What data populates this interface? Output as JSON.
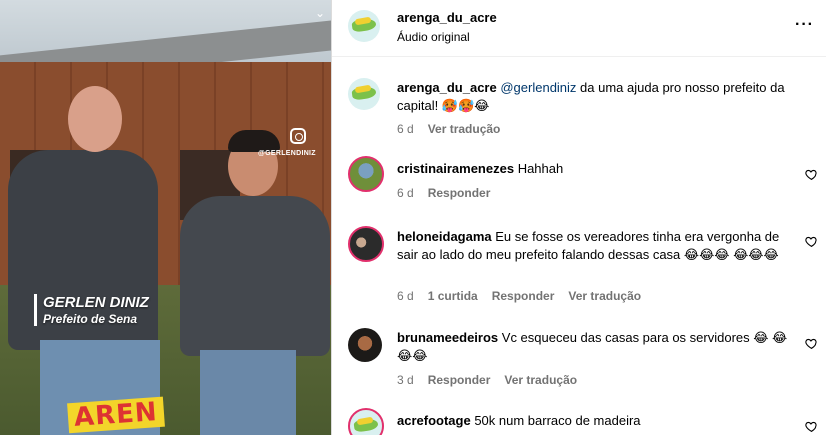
{
  "media": {
    "overlay_name": "GERLEN DINIZ",
    "overlay_role": "Prefeito de Sena",
    "watermark_handle": "@GERLENDINIZ",
    "logo_text": "AREN"
  },
  "header": {
    "username": "arenga_du_acre",
    "audio": "Áudio original",
    "more_icon": "more-icon"
  },
  "caption": {
    "username": "arenga_du_acre",
    "mention": "@gerlendiniz",
    "text": " da uma ajuda pro nosso prefeito da capital! 🥵🥵😂",
    "time": "6 d",
    "translate": "Ver tradução"
  },
  "comments": [
    {
      "username": "cristinairamenezes",
      "text": " Hahhah",
      "time": "6 d",
      "reply": "Responder"
    },
    {
      "username": "heloneidagama",
      "text": " Eu se fosse os vereadores tinha era vergonha de sair ao lado do meu prefeito falando dessas casa 😂😂😂 😂😂😂",
      "time": "6 d",
      "likes": "1 curtida",
      "reply": "Responder",
      "translate": "Ver tradução"
    },
    {
      "username": "brunameedeiros",
      "text": " Vc esqueceu das casas para os servidores 😂 😂😂😂",
      "time": "3 d",
      "reply": "Responder",
      "translate": "Ver tradução"
    },
    {
      "username": "acrefootage",
      "text": " 50k num barraco de madeira"
    }
  ],
  "colors": {
    "mention": "#00376b",
    "meta": "#737373",
    "ring": "#e1306c"
  }
}
